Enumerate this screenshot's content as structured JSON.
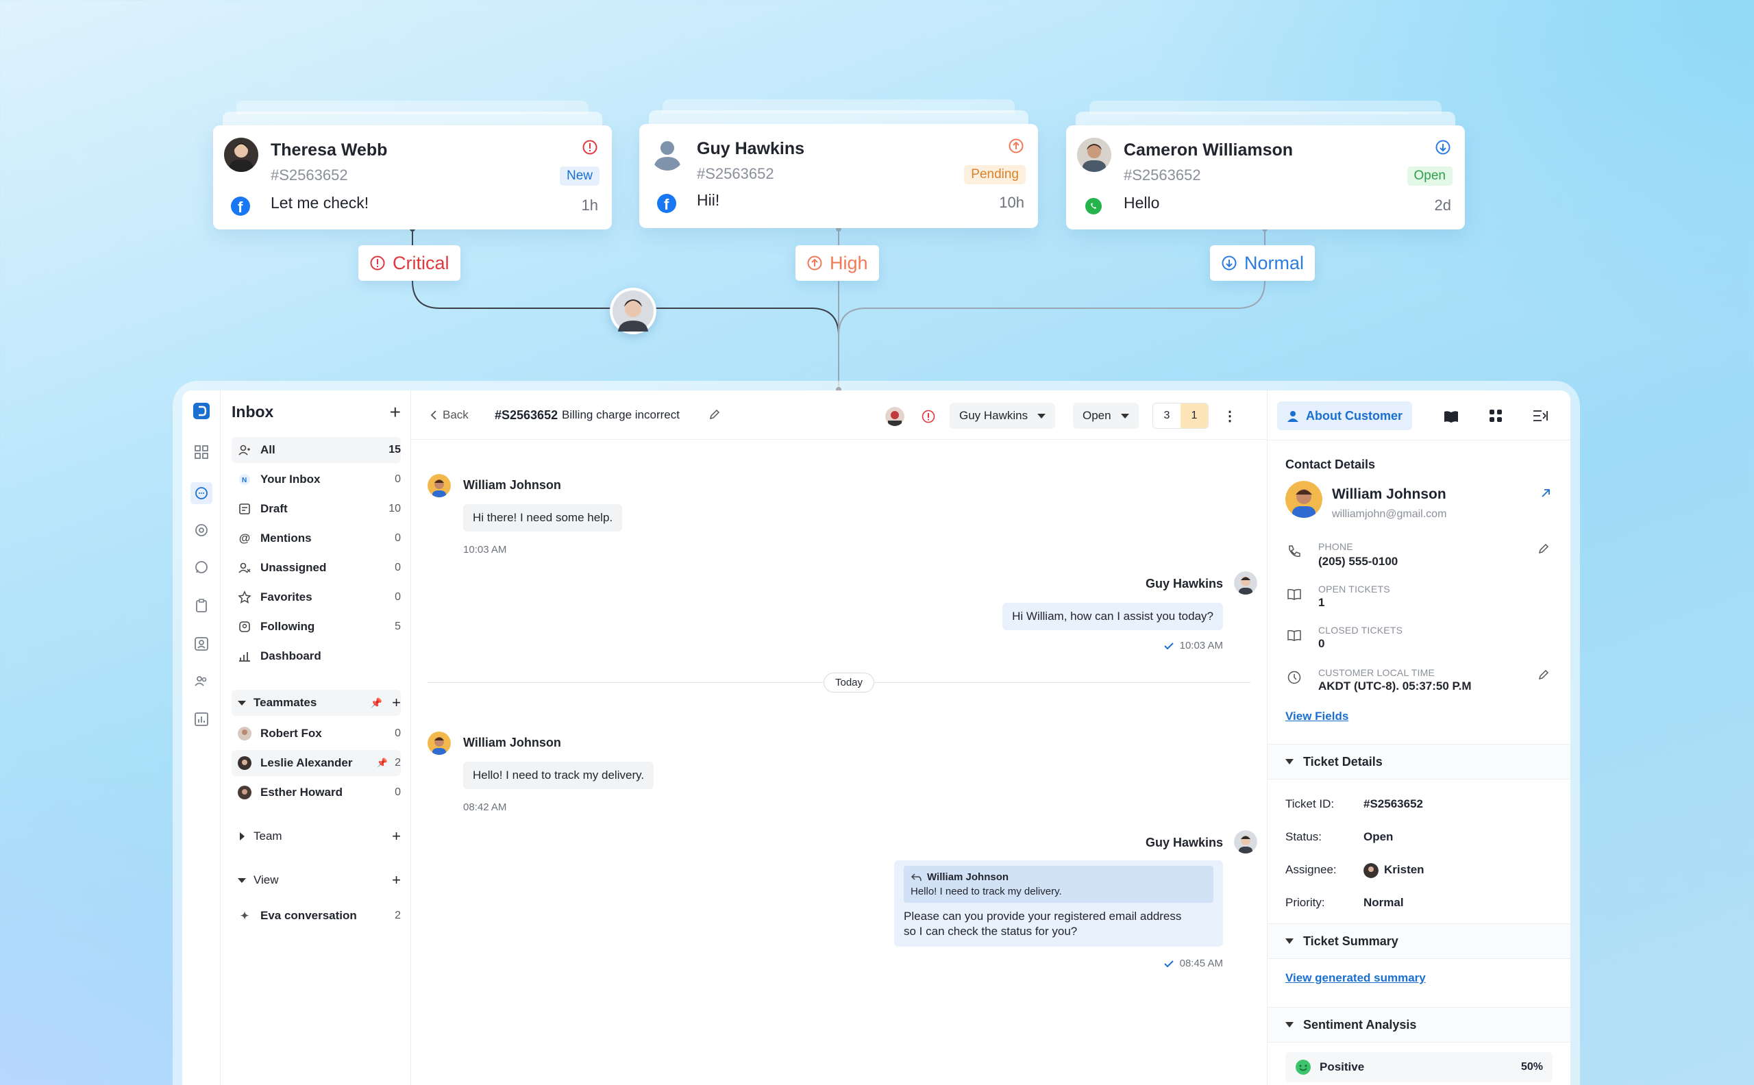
{
  "tickets": [
    {
      "name": "Theresa Webb",
      "id": "#S2563652",
      "message": "Let me check!",
      "status": "New",
      "time": "1h",
      "channel": "facebook",
      "priority_icon": "alert-circle-icon",
      "priority_color": "#e0383e",
      "status_bg": "#e6f0fd",
      "status_color": "#1a6fd0"
    },
    {
      "name": "Guy Hawkins",
      "id": "#S2563652",
      "message": "Hii!",
      "status": "Pending",
      "time": "10h",
      "channel": "facebook",
      "priority_icon": "arrow-up-circle-icon",
      "priority_color": "#f07a55",
      "status_bg": "#fdf0de",
      "status_color": "#d9822b"
    },
    {
      "name": "Cameron Williamson",
      "id": "#S2563652",
      "message": "Hello",
      "status": "Open",
      "time": "2d",
      "channel": "whatsapp",
      "priority_icon": "arrow-down-circle-icon",
      "priority_color": "#2a7be4",
      "status_bg": "#e3f8e7",
      "status_color": "#2f9e4d"
    }
  ],
  "priorities": [
    {
      "label": "Critical",
      "color": "#e0383e"
    },
    {
      "label": "High",
      "color": "#f07a55"
    },
    {
      "label": "Normal",
      "color": "#2a7be4"
    }
  ],
  "sidebar": {
    "title": "Inbox",
    "items": [
      {
        "label": "All",
        "count": "15",
        "icon": "users-icon"
      },
      {
        "label": "Your Inbox",
        "count": "0",
        "icon": "inbox-badge-icon"
      },
      {
        "label": "Draft",
        "count": "10",
        "icon": "draft-icon"
      },
      {
        "label": "Mentions",
        "count": "0",
        "icon": "at-icon"
      },
      {
        "label": "Unassigned",
        "count": "0",
        "icon": "user-x-icon"
      },
      {
        "label": "Favorites",
        "count": "0",
        "icon": "star-icon"
      },
      {
        "label": "Following",
        "count": "5",
        "icon": "following-icon"
      },
      {
        "label": "Dashboard",
        "count": "",
        "icon": "chart-icon"
      }
    ],
    "teammates_label": "Teammates",
    "teammates": [
      {
        "label": "Robert Fox",
        "count": "0"
      },
      {
        "label": "Leslie Alexander",
        "count": "2"
      },
      {
        "label": "Esther Howard",
        "count": "0"
      }
    ],
    "team_label": "Team",
    "view_label": "View",
    "view_items": [
      {
        "label": "Eva conversation",
        "count": "2"
      }
    ]
  },
  "chat": {
    "back": "Back",
    "ticket_id": "#S2563652",
    "subject": "Billing charge incorrect",
    "assignee": "Guy Hawkins",
    "status": "Open",
    "count_a": "3",
    "count_b": "1",
    "messages": [
      {
        "sender": "William Johnson",
        "text": "Hi there! I need some help.",
        "time": "10:03 AM"
      },
      {
        "sender": "Guy Hawkins",
        "text": "Hi William, how can I assist you today?",
        "time": "10:03 AM"
      },
      {
        "sender": "William Johnson",
        "text": "Hello! I need to track my delivery.",
        "time": "08:42 AM"
      },
      {
        "sender": "Guy Hawkins",
        "quote_name": "William Johnson",
        "quote_text": "Hello! I need to track my delivery.",
        "text_line1": "Please can you provide your registered email address",
        "text_line2": "so I can check the status for you?",
        "time": "08:45 AM"
      }
    ],
    "divider": "Today"
  },
  "right": {
    "tab_about": "About Customer",
    "contact_details": "Contact Details",
    "name": "William Johnson",
    "email": "williamjohn@gmail.com",
    "phone_label": "PHONE",
    "phone": "(205) 555-0100",
    "open_label": "OPEN TICKETS",
    "open": "1",
    "closed_label": "CLOSED TICKETS",
    "closed": "0",
    "time_label": "CUSTOMER LOCAL TIME",
    "time": "AKDT (UTC-8). 05:37:50 P.M",
    "view_fields": "View Fields",
    "ticket_details": "Ticket Details",
    "tid_label": "Ticket ID:",
    "tid": "#S2563652",
    "status_label": "Status:",
    "status": "Open",
    "assignee_label": "Assignee:",
    "assignee": "Kristen",
    "priority_label": "Priority:",
    "priority": "Normal",
    "ticket_summary": "Ticket Summary",
    "view_summary": "View generated summary",
    "sentiment": "Sentiment Analysis",
    "sentiment_value": "Positive",
    "sentiment_pct": "50%"
  }
}
